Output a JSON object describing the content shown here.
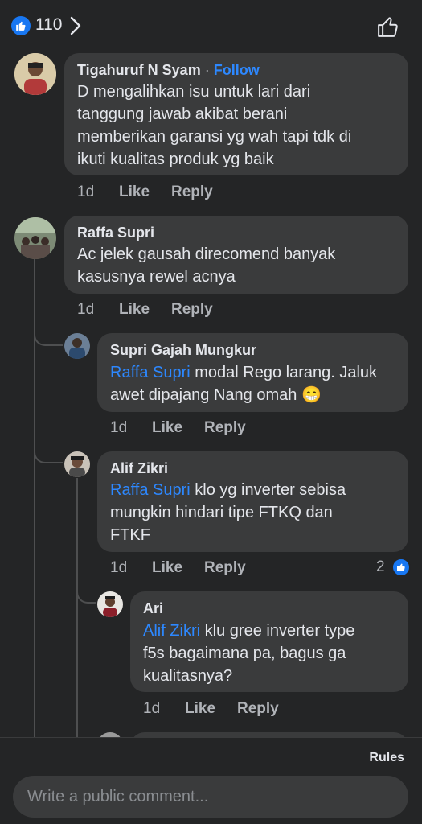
{
  "header": {
    "reaction_count": "110",
    "like_icon": "like-thumb-icon",
    "chevron_icon": "chevron-right-icon",
    "react_icon": "thumbs-up-outline-icon"
  },
  "comments": [
    {
      "author": "Tigahuruf N Syam",
      "separator": " · ",
      "follow": "Follow",
      "lines": [
        "D mengalihkan isu untuk lari dari",
        "tanggung jawab akibat berani",
        "memberikan garansi yg wah tapi tdk di",
        "ikuti kualitas produk yg baik"
      ],
      "time": "1d",
      "like": "Like",
      "reply": "Reply"
    },
    {
      "author": "Raffa Supri",
      "lines": [
        "Ac jelek gausah direcomend banyak",
        "kasusnya rewel acnya"
      ],
      "time": "1d",
      "like": "Like",
      "reply": "Reply"
    },
    {
      "author": "Supri Gajah Mungkur",
      "mention": "Raffa Supri",
      "line1_rest": " modal Rego larang. Jaluk",
      "line2": "awet dipajang Nang omah ",
      "emoji": "😁",
      "time": "1d",
      "like": "Like",
      "reply": "Reply"
    },
    {
      "author": "Alif Zikri",
      "mention": "Raffa Supri",
      "line1_rest": " klo yg inverter sebisa",
      "line2": "mungkin hindari tipe FTKQ dan",
      "line3": "FTKF",
      "time": "1d",
      "like": "Like",
      "reply": "Reply",
      "reaction_count": "2"
    },
    {
      "author": "Ari",
      "mention": "Alif Zikri",
      "line1_rest": " klu gree inverter type",
      "line2": "f5s bagaimana pa, bagus ga",
      "line3": "kualitasnya?",
      "time": "1d",
      "like": "Like",
      "reply": "Reply"
    }
  ],
  "footer": {
    "rules": "Rules",
    "placeholder": "Write a public comment..."
  },
  "colors": {
    "background": "#242526",
    "bubble": "#3a3b3c",
    "link": "#2d88ff",
    "accent": "#1877f2"
  }
}
